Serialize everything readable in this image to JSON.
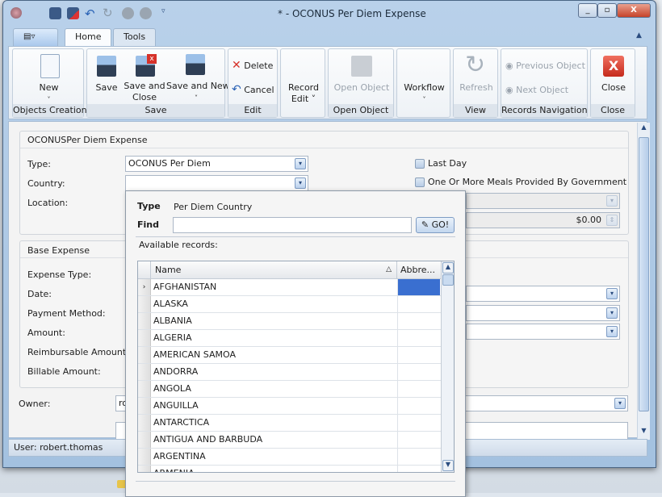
{
  "window": {
    "title": "* - OCONUS Per Diem Expense"
  },
  "ribbon": {
    "tabs": [
      {
        "label": "Home",
        "active": true
      },
      {
        "label": "Tools",
        "active": false
      }
    ],
    "groups": {
      "objects_creation": {
        "label": "Objects Creation",
        "new": "New"
      },
      "save": {
        "label": "Save",
        "save": "Save",
        "save_and_close_1": "Save and",
        "save_and_close_2": "Close",
        "save_and_new": "Save and New"
      },
      "edit": {
        "label": "Edit",
        "delete": "Delete",
        "cancel": "Cancel"
      },
      "record_edit": {
        "label_1": "Record",
        "label_2": "Edit"
      },
      "open_object": {
        "label": "Open Object",
        "button": "Open Object"
      },
      "workflow": {
        "button": "Workflow"
      },
      "view": {
        "label": "View",
        "refresh": "Refresh"
      },
      "records_navigation": {
        "label": "Records Navigation",
        "previous": "Previous Object",
        "next": "Next Object"
      },
      "close": {
        "label": "Close",
        "button": "Close"
      }
    }
  },
  "form": {
    "group1": {
      "title": "OCONUSPer Diem Expense",
      "type_label": "Type:",
      "type_value": "OCONUS Per Diem",
      "country_label": "Country:",
      "country_value": "",
      "location_label": "Location:",
      "last_day": "Last Day",
      "meals": "One Or More Meals Provided By Government",
      "amount_value": "$0.00"
    },
    "group2": {
      "title": "Base Expense",
      "expense_type": "Expense Type:",
      "date": "Date:",
      "payment_method": "Payment Method:",
      "amount": "Amount:",
      "reimbursable": "Reimbursable Amount:",
      "billable": "Billable Amount:"
    },
    "owner_label": "Owner:",
    "owner_value": "ro"
  },
  "status": {
    "user": "User: robert.thomas"
  },
  "lookup": {
    "type_label": "Type",
    "type_value": "Per Diem Country",
    "find_label": "Find",
    "find_value": "",
    "go": "GO!",
    "available": "Available records:",
    "columns": [
      "Name",
      "Abbre..."
    ],
    "rows": [
      "AFGHANISTAN",
      "ALASKA",
      "ALBANIA",
      "ALGERIA",
      "AMERICAN SAMOA",
      "ANDORRA",
      "ANGOLA",
      "ANGUILLA",
      "ANTARCTICA",
      "ANTIGUA AND BARBUDA",
      "ARGENTINA",
      "ARMENIA"
    ],
    "selected_index": 0
  }
}
